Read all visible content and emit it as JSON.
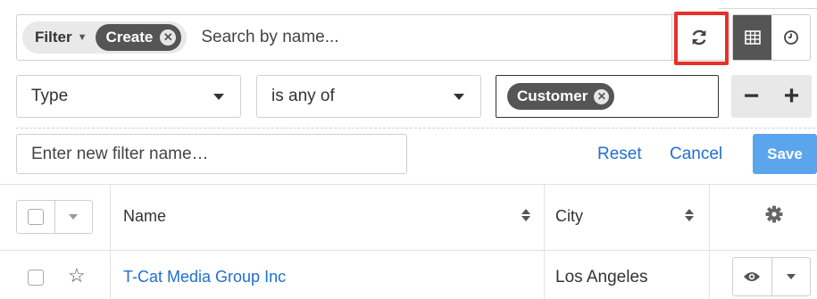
{
  "search_bar": {
    "filter_label": "Filter",
    "active_filter": "Create",
    "placeholder": "Search by name..."
  },
  "filter_row": {
    "field": "Type",
    "operator": "is any of",
    "value_tag": "Customer",
    "remove_label": "−",
    "add_label": "+"
  },
  "filter_name": {
    "placeholder": "Enter new filter name…",
    "reset_label": "Reset",
    "cancel_label": "Cancel",
    "save_label": "Save"
  },
  "table": {
    "columns": [
      "Name",
      "City"
    ],
    "rows": [
      {
        "name": "T-Cat Media Group Inc",
        "city": "Los Angeles"
      }
    ]
  },
  "icons": {
    "refresh": "refresh-icon",
    "list_view": "table-icon",
    "activity_stream": "clock-icon",
    "settings": "gear-icon",
    "preview": "eye-icon",
    "favorite": "star-icon"
  },
  "colors": {
    "highlight": "#e8302a",
    "link": "#1f6fd1",
    "save_button": "#5aa5ec",
    "pill": "#555555"
  }
}
